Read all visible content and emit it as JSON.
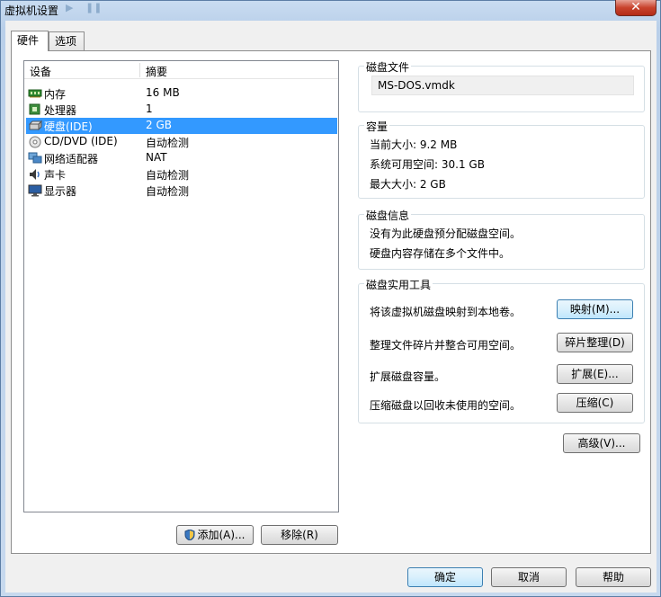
{
  "window": {
    "title": "虚拟机设置",
    "close_label": "✕"
  },
  "tabs": [
    {
      "label": "硬件",
      "active": true
    },
    {
      "label": "选项",
      "active": false
    }
  ],
  "device_list": {
    "columns": [
      "设备",
      "摘要"
    ],
    "rows": [
      {
        "name": "内存",
        "summary": "16 MB",
        "icon": "memory-icon",
        "selected": false
      },
      {
        "name": "处理器",
        "summary": "1",
        "icon": "processor-icon",
        "selected": false
      },
      {
        "name": "硬盘(IDE)",
        "summary": "2 GB",
        "icon": "hard-disk-icon",
        "selected": true
      },
      {
        "name": "CD/DVD (IDE)",
        "summary": "自动检测",
        "icon": "cd-dvd-icon",
        "selected": false
      },
      {
        "name": "网络适配器",
        "summary": "NAT",
        "icon": "network-adapter-icon",
        "selected": false
      },
      {
        "name": "声卡",
        "summary": "自动检测",
        "icon": "sound-card-icon",
        "selected": false
      },
      {
        "name": "显示器",
        "summary": "自动检测",
        "icon": "display-icon",
        "selected": false
      }
    ]
  },
  "list_buttons": {
    "add": "添加(A)...",
    "remove": "移除(R)"
  },
  "disk_file": {
    "title": "磁盘文件",
    "value": "MS-DOS.vmdk"
  },
  "capacity": {
    "title": "容量",
    "current_size": "当前大小: 9.2 MB",
    "free_space": "系统可用空间: 30.1 GB",
    "max_size": "最大大小: 2 GB"
  },
  "disk_info": {
    "title": "磁盘信息",
    "line1": "没有为此硬盘预分配磁盘空间。",
    "line2": "硬盘内容存储在多个文件中。"
  },
  "disk_utilities": {
    "title": "磁盘实用工具",
    "map_desc": "将该虚拟机磁盘映射到本地卷。",
    "map_btn": "映射(M)...",
    "defrag_desc": "整理文件碎片并整合可用空间。",
    "defrag_btn": "碎片整理(D)",
    "expand_desc": "扩展磁盘容量。",
    "expand_btn": "扩展(E)...",
    "compact_desc": "压缩磁盘以回收未使用的空间。",
    "compact_btn": "压缩(C)"
  },
  "advanced_btn": "高级(V)...",
  "dialog_buttons": {
    "ok": "确定",
    "cancel": "取消",
    "help": "帮助"
  }
}
